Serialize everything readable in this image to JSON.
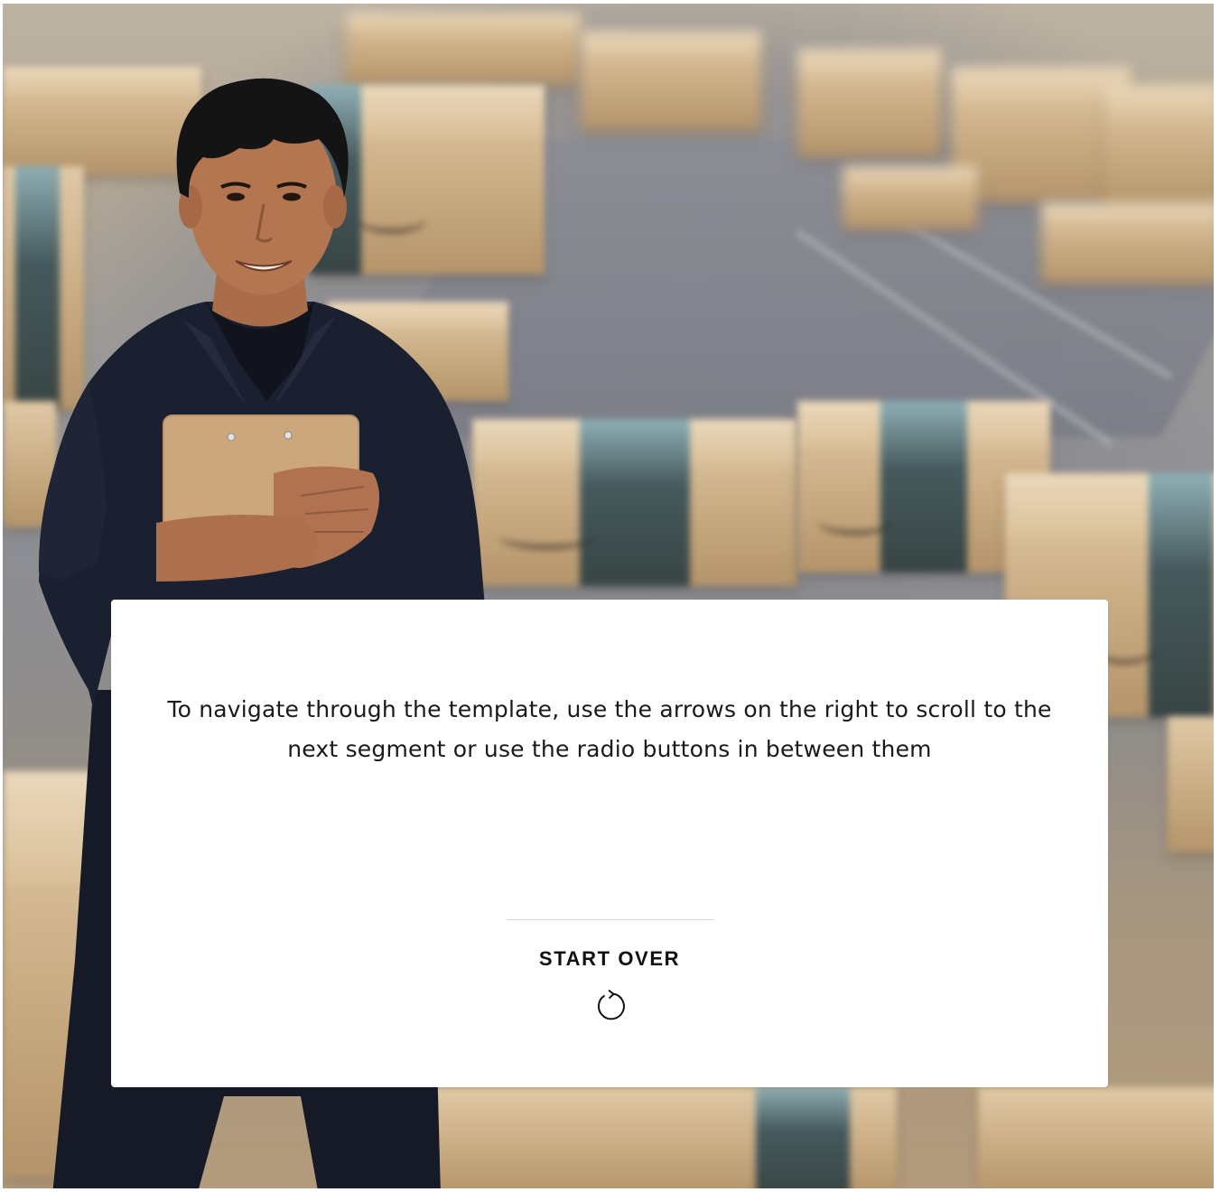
{
  "card": {
    "message": "To navigate through the template, use the arrows on the right to scroll to the next segment or use the radio buttons in between them",
    "start_over_label": "START OVER",
    "restart_icon": "restart-icon"
  },
  "background": {
    "scene": "warehouse-boxes-photo",
    "person": "worker-with-clipboard-photo"
  }
}
